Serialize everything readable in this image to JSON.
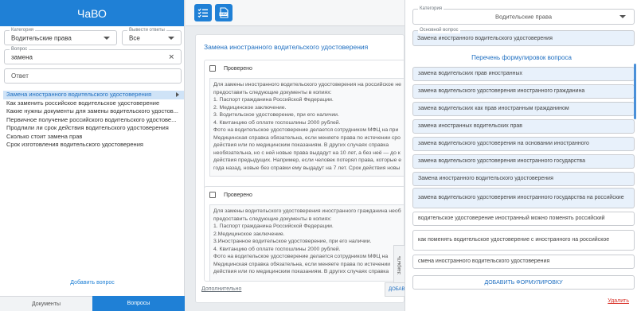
{
  "left": {
    "title": "ЧаВО",
    "category": {
      "label": "Категория",
      "value": "Водительские права"
    },
    "output": {
      "label": "Вывести ответы",
      "value": "Все"
    },
    "question": {
      "label": "Вопрос",
      "value": "замена"
    },
    "answer_placeholder": "Ответ",
    "questions": [
      "Замена иностранного водительского удостоверения",
      "Как заменить российское водительское удостоверение",
      "Какие нужны документы для замены водительского удостов...",
      "Первичное получение российского водительского удостове...",
      "Продлили ли срок действия водительского удостоверения",
      "Сколько стоит замена прав",
      "Срок изготовления водительского удостоверения"
    ],
    "add_question": "Добавить вопрос",
    "tabs": {
      "documents": "Документы",
      "questions": "Вопросы"
    }
  },
  "middle": {
    "card_title": "Замена иностранного водительского удостоверения",
    "answers": [
      {
        "checked_label": "Проверено",
        "lines": [
          "Для замены иностранного водительского удостоверения на российское не",
          "предоставить следующие документы в копиях:",
          "1. Паспорт гражданина Российской Федерации.",
          "2. Медицинское заключение.",
          "3. Водительское удостоверение, при его наличии.",
          "4. Квитанцию об оплате госпошлины 2000 рублей.",
          "Фото на водительское удостоверение делается сотрудником МФЦ на при",
          "Медицинская справка обязательна, если меняете права по истечении сро",
          "действия или по медицинским показаниям. В других случаях справка",
          "необязательна, но с ней новые права выдадут на 10 лет, а без неё — до к",
          "действия предыдущих. Например, если человек потерял права, которые е",
          "года назад, новые без справки ему выдадут на 7 лет. Срок действия новы"
        ]
      },
      {
        "checked_label": "Проверено",
        "lines": [
          "Для замены водительского удостоверения иностранного гражданина необ",
          "предоставить следующие документы в копиях:",
          "1. Паспорт гражданина Российской Федерации.",
          "2.Медицинское заключение.",
          "3.Иностранное водительское удостоверение, при его наличии.",
          "4. Квитанцию об оплате госпошлины 2000 рублей.",
          "Фото на водительское удостоверение делается сотрудником МФЦ на",
          "Медицинская справка обязательна, если меняете права по истечении",
          "действия или по медицинским показаниям. В других случаях справка"
        ]
      }
    ],
    "detail_link": "Дополнительно",
    "close_side": "Закрыть",
    "add_side": "ДОБАВИТЬ"
  },
  "right": {
    "category": {
      "label": "Категория",
      "value": "Водительские права"
    },
    "main_question": {
      "label": "Основной вопрос",
      "value": "Замена иностранного водительского удостоверения"
    },
    "formulations_heading": "Перечень формулировок вопроса",
    "formulations": [
      {
        "text": "замена водительских прав иностранных",
        "style": "blue"
      },
      {
        "text": "замена водительского удостоверения иностранного гражданина",
        "style": "blue"
      },
      {
        "text": "замена водительских как прав иностранным гражданином",
        "style": "blue"
      },
      {
        "text": "замена иностранных водительских прав",
        "style": "blue"
      },
      {
        "text": "замена водительского удостоверения на основании иностранного",
        "style": "blue"
      },
      {
        "text": "замена водительского удостоверения иностранного государства",
        "style": "blue"
      },
      {
        "text": "Замена иностранного водительского удостоверения",
        "style": "blue"
      },
      {
        "text": "замена водительского удостоверения иностранного государства на российские",
        "style": "blue"
      },
      {
        "text": "водительское удостоверение иностранный можно поменять российский",
        "style": "white"
      },
      {
        "text": "как поменять водительское удостоверение с иностранного на российское",
        "style": "white"
      },
      {
        "text": "смена иностранного водительского удостоверения",
        "style": "white"
      }
    ],
    "add_formulation": "ДОБАВИТЬ ФОРМУЛИРОВКУ",
    "delete": "Удалить"
  }
}
